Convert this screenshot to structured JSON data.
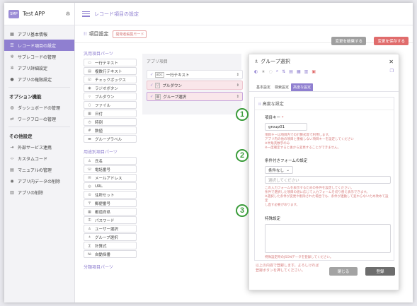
{
  "sidebar": {
    "app_name": "Test APP",
    "logo_text": "SMP",
    "pin_icon": "pin-icon",
    "items": [
      {
        "label": "アプリ基本情報",
        "icon": "app-icon"
      },
      {
        "label": "レコード項目の設定",
        "icon": "list-icon",
        "active": true
      },
      {
        "label": "サブレコードの管理",
        "icon": "gear-icon"
      },
      {
        "label": "アプリ詳細設定",
        "icon": "gear-icon"
      },
      {
        "label": "アプリの権限設定",
        "icon": "lock-icon"
      }
    ],
    "section_option": "オプション機能",
    "option_items": [
      {
        "label": "ダッシュボードの管理",
        "icon": "dashboard-icon"
      },
      {
        "label": "ワークフローの管理",
        "icon": "flow-icon"
      }
    ],
    "section_other": "その他設定",
    "other_items": [
      {
        "label": "外部サービス連携",
        "icon": "link-icon"
      },
      {
        "label": "カスタムコード",
        "icon": "code-icon"
      },
      {
        "label": "マニュアルの管理",
        "icon": "book-icon"
      },
      {
        "label": "アプリ内データの削除",
        "icon": "database-icon"
      },
      {
        "label": "アプリの削除",
        "icon": "trash-icon"
      }
    ]
  },
  "header": {
    "title": "レコード項目の設定"
  },
  "page": {
    "title": "項目設定",
    "mode_badge": "開発者編集モード",
    "discard_label": "変更を破棄する",
    "save_label": "変更を保存する"
  },
  "parts": {
    "general_title": "汎用項目パーツ",
    "general": [
      "一行テキスト",
      "複数行テキスト",
      "チェックボックス",
      "ラジオボタン",
      "プルダウン",
      "ファイル",
      "日付",
      "時刻",
      "数値",
      "グループラベル"
    ],
    "special_title": "用途別項目パーツ",
    "special": [
      "氏名",
      "電話番号",
      "メールアドレス",
      "URL",
      "住所セット",
      "郵便番号",
      "都道府県",
      "パスワード",
      "ユーザー選択",
      "グループ選択",
      "計算式",
      "自動採番"
    ],
    "layout_title": "分類項目パーツ"
  },
  "form": {
    "label": "アプリ項目",
    "rows": [
      {
        "label": "一行テキスト",
        "icon_text": "abc"
      },
      {
        "label": "プルダウン",
        "icon_text": "▽"
      },
      {
        "label": "グループ選択",
        "icon_text": "▦"
      }
    ]
  },
  "dialog": {
    "title": "グループ選択",
    "tabs": [
      "基本設定",
      "検索設定",
      "高度な設定"
    ],
    "active_tab": 2,
    "section_title": "高度な設定",
    "key_label": "項目キー",
    "required_mark": "*",
    "key_value": "group01",
    "key_note_lines": [
      "項目キーは項目内での計算式等で利用します。",
      "アプリ内の他の項目と重複しない項目キーを設定してください",
      "※半角英数字のみ",
      "※一度確定すると後から変更することができません。"
    ],
    "cond_label": "条件付きフォームの設定",
    "cond_select": "条件なし",
    "cond_placeholder": "選択してください",
    "cond_note_lines": [
      "この入力フォームを表示するための条件を設定してください。",
      "条件で選択した項目の値に応じて入力フォームを切り替え表示できます。",
      "※選択した条件が変更や削除された場合でも、条件が連動して変わらないため改めて設定",
      "し直す必要があります。"
    ],
    "special_label": "特殊設定",
    "special_note": "特殊設定時のJSONデータを登録してください。",
    "footer_note": "以上の内容で登録します。よろしければ登録ボタンを押してください。",
    "close_label": "閉じる",
    "register_label": "登録"
  },
  "markers": [
    "1",
    "2",
    "3"
  ]
}
